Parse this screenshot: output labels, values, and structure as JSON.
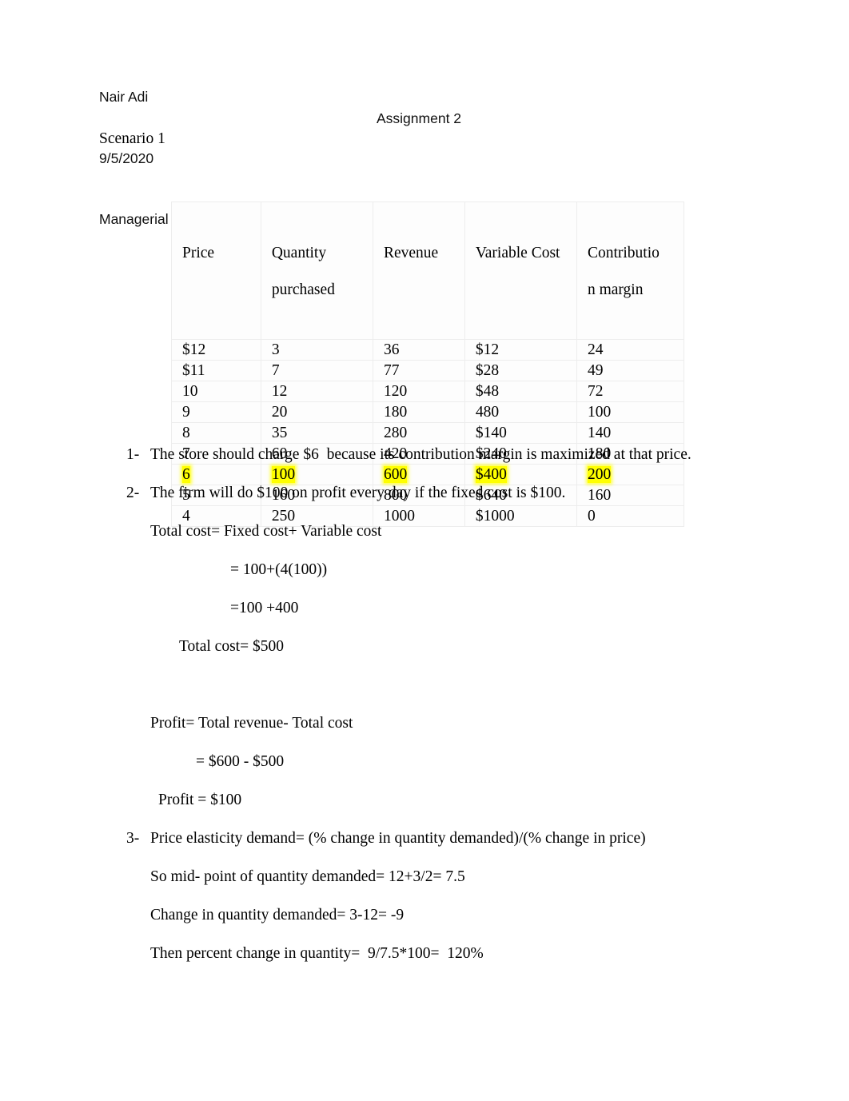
{
  "document": {
    "header": {
      "author": "Nair Adi",
      "date": "9/5/2020",
      "course": "Managerial Economics",
      "assignment_title": "Assignment 2",
      "scenario_label": "Scenario 1"
    },
    "table": {
      "columns": [
        {
          "line1": "Price",
          "line2": ""
        },
        {
          "line1": "Quantity",
          "line2": "purchased"
        },
        {
          "line1": "Revenue",
          "line2": ""
        },
        {
          "line1": "Variable Cost",
          "line2": ""
        },
        {
          "line1": "Contributio",
          "line2": "n margin"
        }
      ],
      "rows": [
        {
          "price": "$12",
          "quantity": "3",
          "revenue": "36",
          "variable_cost": "$12",
          "contribution_margin": "24",
          "highlighted": false
        },
        {
          "price": "$11",
          "quantity": "7",
          "revenue": "77",
          "variable_cost": "$28",
          "contribution_margin": "49",
          "highlighted": false
        },
        {
          "price": "10",
          "quantity": "12",
          "revenue": "120",
          "variable_cost": "$48",
          "contribution_margin": "72",
          "highlighted": false
        },
        {
          "price": "9",
          "quantity": "20",
          "revenue": "180",
          "variable_cost": "480",
          "contribution_margin": "100",
          "highlighted": false
        },
        {
          "price": "8",
          "quantity": "35",
          "revenue": "280",
          "variable_cost": "$140",
          "contribution_margin": "140",
          "highlighted": false
        },
        {
          "price": "7",
          "quantity": "60",
          "revenue": "420",
          "variable_cost": "$240",
          "contribution_margin": "180",
          "highlighted": false
        },
        {
          "price": "6",
          "quantity": "100",
          "revenue": "600",
          "variable_cost": "$400",
          "contribution_margin": "200",
          "highlighted": true
        },
        {
          "price": "5",
          "quantity": "160",
          "revenue": "800",
          "variable_cost": "$640",
          "contribution_margin": "160",
          "highlighted": false
        },
        {
          "price": "4",
          "quantity": "250",
          "revenue": "1000",
          "variable_cost": "$1000",
          "contribution_margin": "0",
          "highlighted": false
        }
      ],
      "highlight_color": "#ffff00"
    },
    "answers": {
      "item1_marker": "1-",
      "item1_text": "The store should charge $6  because its contribution margin is maximized at that price.",
      "item2_marker": "2-",
      "item2_text": "The firm will do $100 on profit every day if the fixed cost is $100.",
      "item2_line1": "Total cost= Fixed cost+ Variable cost",
      "item2_line2": "= 100+(4(100))",
      "item2_line3": "=100 +400",
      "item2_line4": "Total cost= $500",
      "item2_line5": "Profit= Total revenue- Total cost",
      "item2_line6": "= $600 - $500",
      "item2_line7": "Profit = $100",
      "item3_marker": "3-",
      "item3_text": "Price elasticity demand= (% change in quantity demanded)/(% change in price)",
      "item3_line1": "So mid- point of quantity demanded= 12+3/2= 7.5",
      "item3_line2": "Change in quantity demanded= 3-12= -9",
      "item3_line3": "Then percent change in quantity=  9/7.5*100=  120%"
    }
  }
}
